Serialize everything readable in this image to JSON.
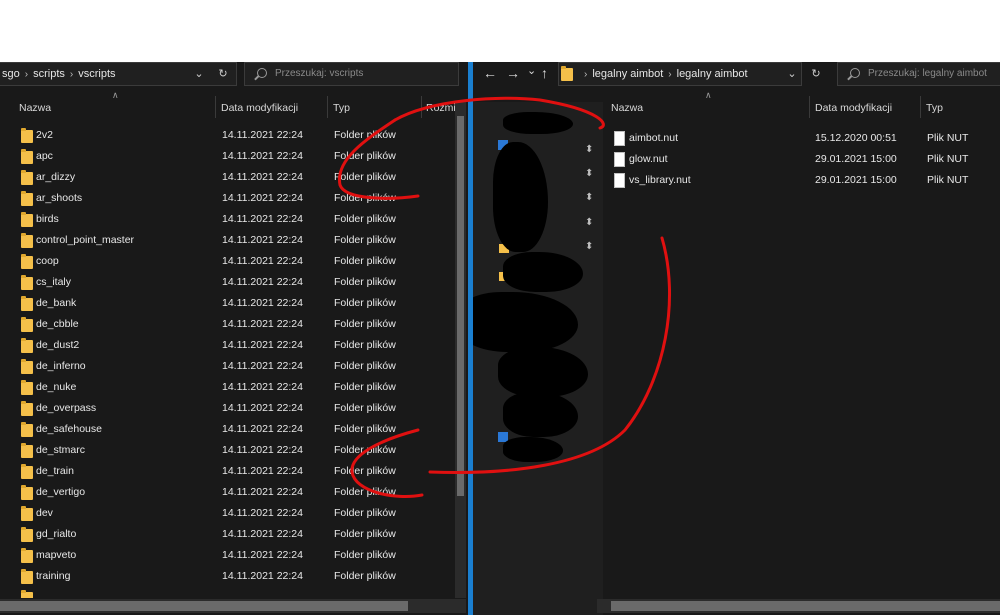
{
  "left": {
    "breadcrumb": [
      "sgo",
      "scripts",
      "vscripts"
    ],
    "search_placeholder": "Przeszukaj: vscripts",
    "columns": [
      "Nazwa",
      "Data modyfikacji",
      "Typ",
      "Rozmi"
    ],
    "rows": [
      {
        "name": "2v2",
        "date": "14.11.2021 22:24",
        "type": "Folder plików"
      },
      {
        "name": "apc",
        "date": "14.11.2021 22:24",
        "type": "Folder plików"
      },
      {
        "name": "ar_dizzy",
        "date": "14.11.2021 22:24",
        "type": "Folder plików"
      },
      {
        "name": "ar_shoots",
        "date": "14.11.2021 22:24",
        "type": "Folder plików"
      },
      {
        "name": "birds",
        "date": "14.11.2021 22:24",
        "type": "Folder plików"
      },
      {
        "name": "control_point_master",
        "date": "14.11.2021 22:24",
        "type": "Folder plików"
      },
      {
        "name": "coop",
        "date": "14.11.2021 22:24",
        "type": "Folder plików"
      },
      {
        "name": "cs_italy",
        "date": "14.11.2021 22:24",
        "type": "Folder plików"
      },
      {
        "name": "de_bank",
        "date": "14.11.2021 22:24",
        "type": "Folder plików"
      },
      {
        "name": "de_cbble",
        "date": "14.11.2021 22:24",
        "type": "Folder plików"
      },
      {
        "name": "de_dust2",
        "date": "14.11.2021 22:24",
        "type": "Folder plików"
      },
      {
        "name": "de_inferno",
        "date": "14.11.2021 22:24",
        "type": "Folder plików"
      },
      {
        "name": "de_nuke",
        "date": "14.11.2021 22:24",
        "type": "Folder plików"
      },
      {
        "name": "de_overpass",
        "date": "14.11.2021 22:24",
        "type": "Folder plików"
      },
      {
        "name": "de_safehouse",
        "date": "14.11.2021 22:24",
        "type": "Folder plików"
      },
      {
        "name": "de_stmarc",
        "date": "14.11.2021 22:24",
        "type": "Folder plików"
      },
      {
        "name": "de_train",
        "date": "14.11.2021 22:24",
        "type": "Folder plików"
      },
      {
        "name": "de_vertigo",
        "date": "14.11.2021 22:24",
        "type": "Folder plików"
      },
      {
        "name": "dev",
        "date": "14.11.2021 22:24",
        "type": "Folder plików"
      },
      {
        "name": "gd_rialto",
        "date": "14.11.2021 22:24",
        "type": "Folder plików"
      },
      {
        "name": "mapveto",
        "date": "14.11.2021 22:24",
        "type": "Folder plików"
      },
      {
        "name": "training",
        "date": "14.11.2021 22:24",
        "type": "Folder plików"
      }
    ]
  },
  "right": {
    "breadcrumb": [
      "legalny aimbot",
      "legalny aimbot"
    ],
    "search_placeholder": "Przeszukaj: legalny aimbot",
    "columns": [
      "Nazwa",
      "Data modyfikacji",
      "Typ"
    ],
    "rows": [
      {
        "name": "aimbot.nut",
        "date": "15.12.2020 00:51",
        "type": "Plik NUT"
      },
      {
        "name": "glow.nut",
        "date": "29.01.2021 15:00",
        "type": "Plik NUT"
      },
      {
        "name": "vs_library.nut",
        "date": "29.01.2021 15:00",
        "type": "Plik NUT"
      }
    ]
  },
  "colors": {
    "window_bg": "#191919",
    "divider": "#1a7fd0",
    "annotation": "#e01010",
    "folder": "#f5c04a"
  },
  "icons": [
    "back-arrow-icon",
    "forward-arrow-icon",
    "up-arrow-icon",
    "refresh-icon",
    "search-icon",
    "folder-icon",
    "file-icon",
    "pin-icon"
  ]
}
